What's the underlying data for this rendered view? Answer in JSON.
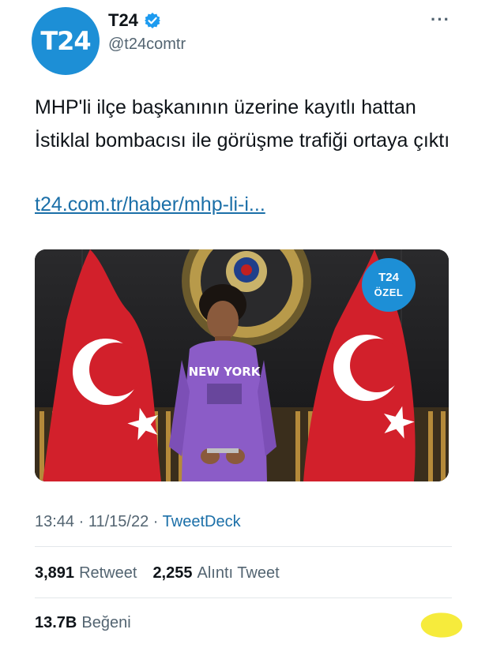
{
  "author": {
    "avatar_text": "T24",
    "name": "T24",
    "handle": "@t24comtr"
  },
  "more_label": "···",
  "tweet": {
    "text": "MHP'li ilçe başkanının üzerine kayıtlı hattan İstiklal bombacısı ile görüşme trafiği ortaya çıktı",
    "link": "t24.com.tr/haber/mhp-li-i..."
  },
  "media": {
    "badge_top": "T24",
    "badge_bottom": "ÖZEL",
    "shirt_text": "NEW YORK"
  },
  "meta": {
    "time": "13:44",
    "separator": " · ",
    "date": "11/15/22",
    "source": "TweetDeck"
  },
  "stats": {
    "retweets_count": "3,891",
    "retweets_label": "Retweet",
    "quotes_count": "2,255",
    "quotes_label": "Alıntı Tweet",
    "likes_count": "13.7B",
    "likes_label": "Beğeni"
  },
  "colors": {
    "brand_blue": "#1d8fd6",
    "link_blue": "#1b6fa8",
    "flag_red": "#d2202b",
    "hoodie_purple": "#8b5cc7",
    "highlight_yellow": "#f5ea31"
  }
}
